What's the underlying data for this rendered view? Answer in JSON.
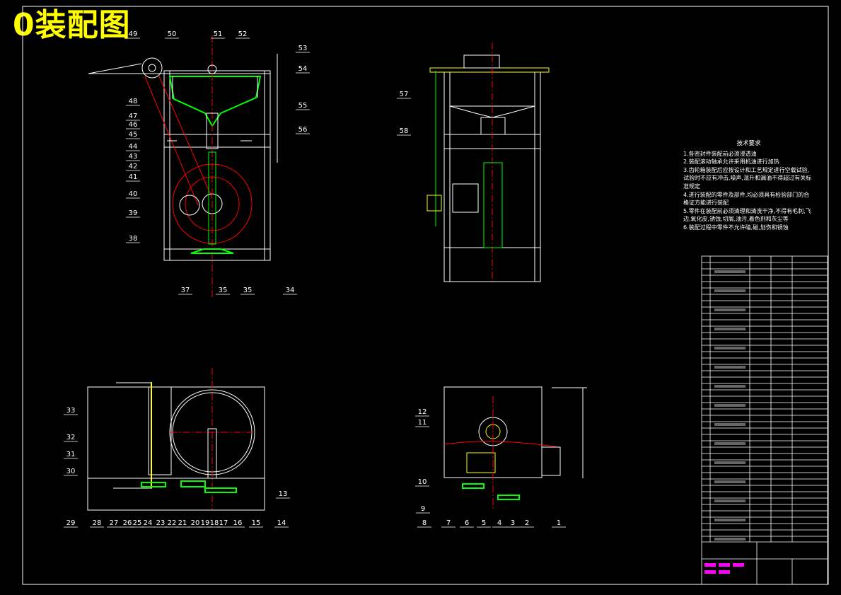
{
  "title": "0装配图",
  "part_labels": [
    "1",
    "2",
    "3",
    "4",
    "5",
    "6",
    "7",
    "8",
    "9",
    "10",
    "11",
    "12",
    "13",
    "14",
    "15",
    "16",
    "17",
    "18",
    "19",
    "20",
    "21",
    "22",
    "23",
    "24",
    "25",
    "26",
    "27",
    "28",
    "29",
    "30",
    "31",
    "32",
    "33",
    "34",
    "35",
    "35",
    "37",
    "38",
    "39",
    "40",
    "41",
    "42",
    "43",
    "44",
    "45",
    "46",
    "47",
    "48",
    "49",
    "50",
    "51",
    "52",
    "53",
    "54",
    "55",
    "56",
    "57",
    "58"
  ],
  "tech_req": {
    "heading": "技术要求",
    "lines": [
      "1.各密封件装配前必须浸透油",
      "2.装配滚动轴承允许采用机油进行加热",
      "3.齿轮箱装配后应按设计和工艺规定进行空载试验,试验时不应有冲击,噪声,温升和漏油不得超过有关标准规定",
      "4.进行装配的零件及部件,均必须具有检验部门的合格证方能进行装配",
      "5.零件在装配前必须清理和清洗干净,不得有毛刺,飞边,氧化皮,锈蚀,切屑,油污,着色剂和灰尘等",
      "6.装配过程中零件不允许磕,碰,划伤和锈蚀"
    ]
  },
  "colors": {
    "background": "#000000",
    "title": "#ffff00",
    "line": "#ffffff",
    "center": "#ff0000",
    "part": "#00ff00",
    "row": "#ff00ff"
  },
  "icons": [
    "title-block-table"
  ]
}
